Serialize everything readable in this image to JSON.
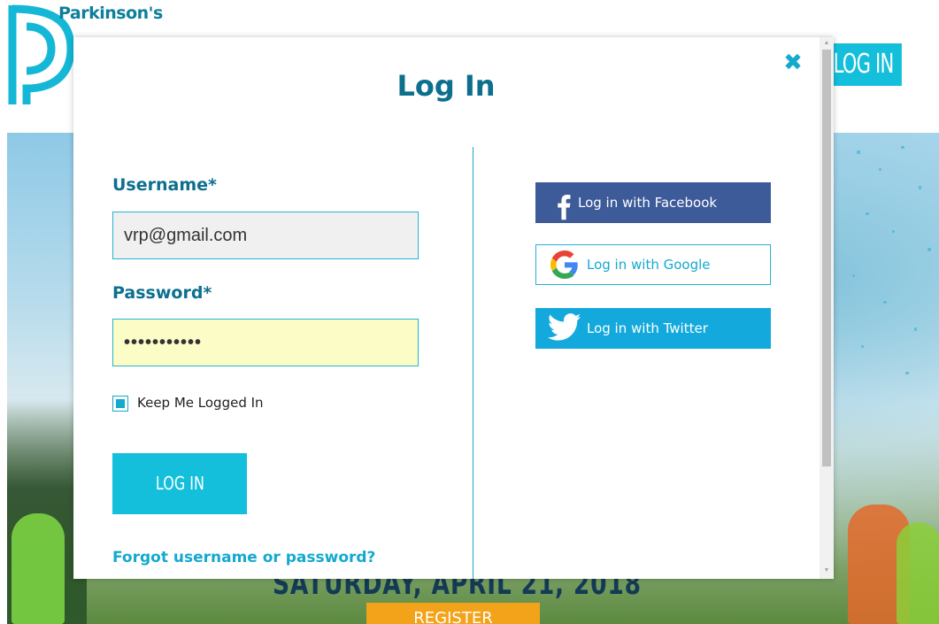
{
  "brand": {
    "name": "Parkinson's"
  },
  "header": {
    "login_label": "LOG IN"
  },
  "hero": {
    "event_text": "SATURDAY, APRIL 21, 2018",
    "register_label": "REGISTER"
  },
  "modal": {
    "title": "Log In",
    "close_icon": "close-icon",
    "username": {
      "label": "Username*",
      "value": "vrp@gmail.com"
    },
    "password": {
      "label": "Password*",
      "value": "•••••••••••"
    },
    "remember": {
      "label": "Keep Me Logged In",
      "checked": true
    },
    "login_button": "LOG IN",
    "forgot_link": "Forgot username or password?",
    "social": {
      "facebook": {
        "label": "Log in with Facebook",
        "icon": "facebook-icon",
        "color": "#3d5a99"
      },
      "google": {
        "label": "Log in with Google",
        "icon": "google-icon",
        "color": "#ffffff"
      },
      "twitter": {
        "label": "Log in with Twitter",
        "icon": "twitter-icon",
        "color": "#14a9dc"
      }
    }
  },
  "colors": {
    "accent": "#14bfdc",
    "title": "#0d6f8e",
    "register": "#f2a31a"
  }
}
